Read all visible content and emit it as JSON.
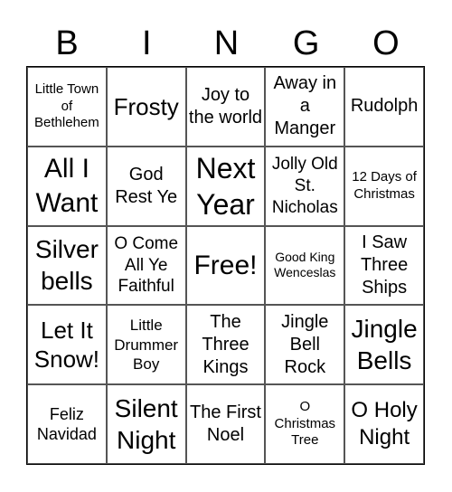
{
  "header": [
    "B",
    "I",
    "N",
    "G",
    "O"
  ],
  "cells": [
    [
      "Little Town of Bethlehem",
      "Frosty",
      "Joy to the world",
      "Away in a Manger",
      "Rudolph"
    ],
    [
      "All I Want",
      "God Rest Ye",
      "Next Year",
      "Jolly Old St. Nicholas",
      "12 Days of Christmas"
    ],
    [
      "Silver bells",
      "O Come All Ye Faithful",
      "Free!",
      "Good King Wenceslas",
      "I Saw Three Ships"
    ],
    [
      "Let It Snow!",
      "Little Drummer Boy",
      "The Three Kings",
      "Jingle Bell Rock",
      "Jingle Bells"
    ],
    [
      "Feliz Navidad",
      "Silent Night",
      "The First Noel",
      "O Christmas Tree",
      "O Holy Night"
    ]
  ]
}
